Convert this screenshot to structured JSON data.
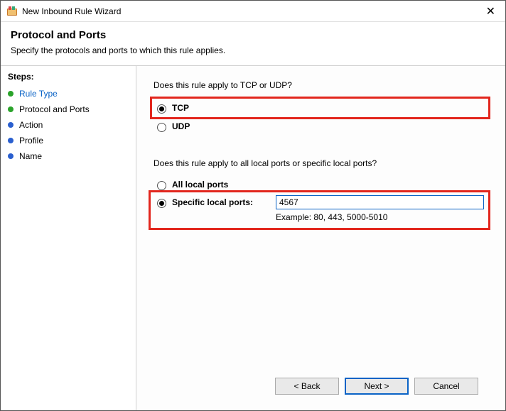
{
  "window": {
    "title": "New Inbound Rule Wizard",
    "close_glyph": "✕"
  },
  "header": {
    "title": "Protocol and Ports",
    "subtitle": "Specify the protocols and ports to which this rule applies."
  },
  "sidebar": {
    "label": "Steps:",
    "items": [
      {
        "label": "Rule Type"
      },
      {
        "label": "Protocol and Ports"
      },
      {
        "label": "Action"
      },
      {
        "label": "Profile"
      },
      {
        "label": "Name"
      }
    ]
  },
  "main": {
    "q_protocol": "Does this rule apply to TCP or UDP?",
    "protocol": {
      "tcp": "TCP",
      "udp": "UDP"
    },
    "q_ports": "Does this rule apply to all local ports or specific local ports?",
    "ports_all": "All local ports",
    "ports_specific": "Specific local ports:",
    "ports_value": "4567",
    "ports_example": "Example: 80, 443, 5000-5010"
  },
  "buttons": {
    "back": "< Back",
    "next": "Next >",
    "cancel": "Cancel"
  }
}
